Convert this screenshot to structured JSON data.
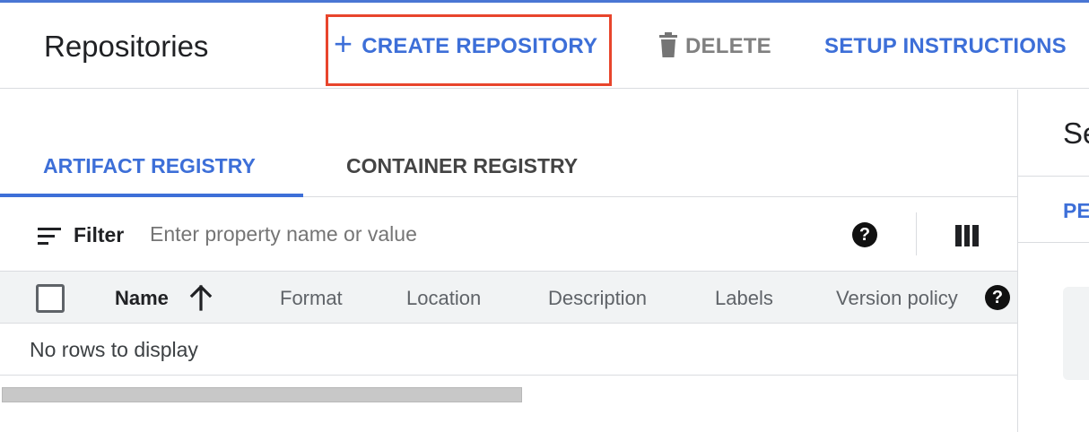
{
  "header": {
    "title": "Repositories",
    "create_label": "CREATE REPOSITORY",
    "delete_label": "DELETE",
    "setup_label": "SETUP INSTRUCTIONS"
  },
  "tabs": [
    {
      "label": "ARTIFACT REGISTRY",
      "active": true
    },
    {
      "label": "CONTAINER REGISTRY",
      "active": false
    }
  ],
  "filter": {
    "label": "Filter",
    "placeholder": "Enter property name or value"
  },
  "table": {
    "columns": [
      "Name",
      "Format",
      "Location",
      "Description",
      "Labels",
      "Version policy"
    ],
    "sort_column": "Name",
    "sort_direction": "ascending",
    "empty_message": "No rows to display"
  },
  "side_panel": {
    "title_partial": "Se",
    "link_partial": "PE"
  },
  "colors": {
    "accent": "#3d6fd8",
    "highlight": "#e8452c",
    "disabled": "#808080"
  },
  "icons": {
    "create": "plus-icon",
    "delete": "trash-icon",
    "filter": "filter-icon",
    "help": "help-icon",
    "columns": "columns-icon",
    "sort": "arrow-up-icon"
  }
}
